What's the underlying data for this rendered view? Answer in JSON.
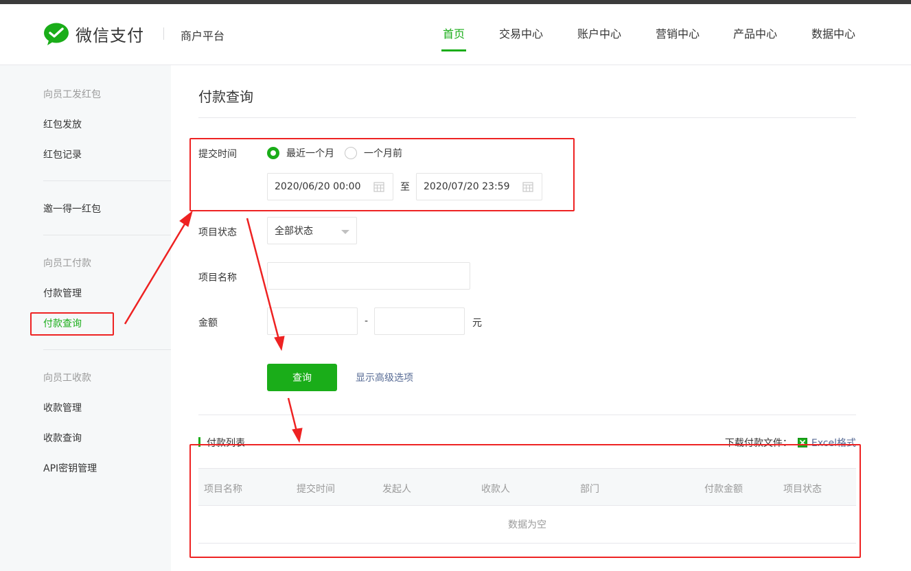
{
  "header": {
    "logo_text": "微信支付",
    "platform": "商户平台",
    "nav": [
      "首页",
      "交易中心",
      "账户中心",
      "营销中心",
      "产品中心",
      "数据中心"
    ],
    "active_nav": "首页"
  },
  "sidebar": {
    "groups": [
      {
        "title": "向员工发红包",
        "items": [
          "红包发放",
          "红包记录"
        ]
      },
      {
        "title": "",
        "items": [
          "邀一得一红包"
        ]
      },
      {
        "title": "向员工付款",
        "items": [
          "付款管理",
          "付款查询"
        ]
      },
      {
        "title": "向员工收款",
        "items": [
          "收款管理",
          "收款查询",
          "API密钥管理"
        ]
      }
    ],
    "active_item": "付款查询"
  },
  "main": {
    "title": "付款查询",
    "form": {
      "submit_time_label": "提交时间",
      "radio_recent": "最近一个月",
      "radio_before": "一个月前",
      "radio_selected": "最近一个月",
      "start_time": "2020/06/20 00:00",
      "to_label": "至",
      "end_time": "2020/07/20 23:59",
      "status_label": "项目状态",
      "status_value": "全部状态",
      "name_label": "项目名称",
      "name_value": "",
      "amount_label": "金额",
      "amount_min": "",
      "amount_sep": "-",
      "amount_max": "",
      "amount_unit": "元",
      "query_button": "查询",
      "advanced_link": "显示高级选项"
    },
    "list": {
      "title": "付款列表",
      "download_label": "下载付款文件：",
      "download_link": "Excel格式",
      "columns": [
        "项目名称",
        "提交时间",
        "发起人",
        "收款人",
        "部门",
        "付款金额",
        "项目状态"
      ],
      "empty_text": "数据为空"
    }
  },
  "colors": {
    "brand_green": "#1aad19",
    "link_blue": "#576b95",
    "annotation_red": "#ee2222"
  }
}
